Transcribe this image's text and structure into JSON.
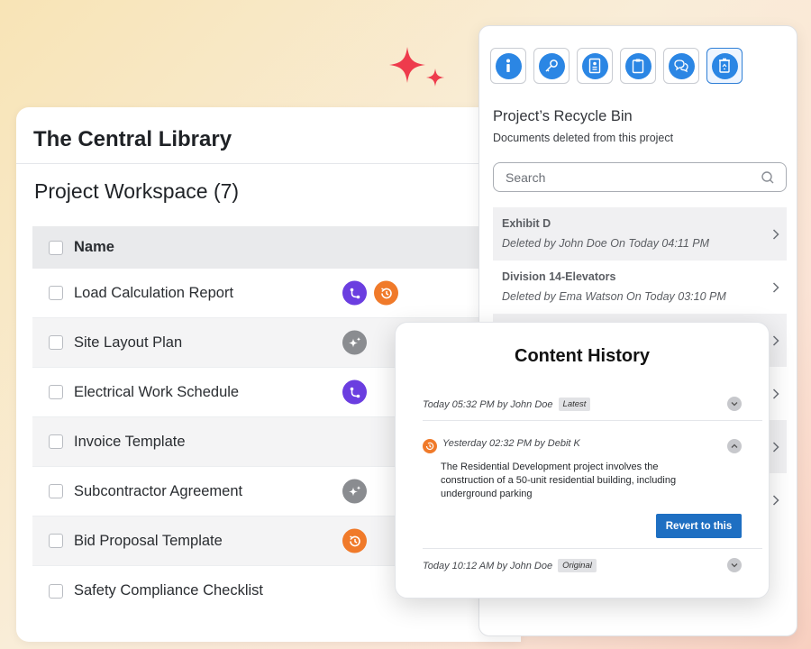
{
  "workspace": {
    "title": "The Central Library",
    "subtitle": "Project Workspace (7)",
    "header_label": "Name",
    "rows": [
      {
        "label": "Load Calculation Report",
        "badges": [
          "workflow-icon",
          "history-icon"
        ]
      },
      {
        "label": "Site Layout Plan",
        "badges": [
          "ai-sparkle-icon"
        ]
      },
      {
        "label": "Electrical Work Schedule",
        "badges": [
          "workflow-icon"
        ]
      },
      {
        "label": "Invoice Template",
        "badges": []
      },
      {
        "label": "Subcontractor Agreement",
        "badges": [
          "ai-sparkle-icon"
        ]
      },
      {
        "label": "Bid Proposal Template",
        "badges": [
          "history-icon"
        ]
      },
      {
        "label": "Safety Compliance Checklist",
        "badges": []
      }
    ]
  },
  "recycle_bin": {
    "toolbar": [
      "info-icon",
      "key-icon",
      "document-card-icon",
      "clipboard-icon",
      "chat-icon",
      "recycle-bin-icon"
    ],
    "title": "Project’s Recycle Bin",
    "subtitle": "Documents deleted from this project",
    "search_placeholder": "Search",
    "items": [
      {
        "name": "Exhibit D",
        "meta": "Deleted by John Doe On Today 04:11 PM"
      },
      {
        "name": "Division 14-Elevators",
        "meta": "Deleted by Ema Watson On Today 03:10 PM"
      }
    ]
  },
  "content_history": {
    "title": "Content History",
    "entries": [
      {
        "line": "Today 05:32 PM by John Doe",
        "tag": "Latest"
      },
      {
        "line": "Yesterday 02:32 PM by Debit K",
        "description": "The Residential Development project involves the construction of a 50-unit residential building, including underground parking"
      },
      {
        "line": "Today 10:12 AM by John Doe",
        "tag": "Original"
      }
    ],
    "revert_label": "Revert to this"
  },
  "colors": {
    "accent_blue": "#2b86e4",
    "button_blue": "#1e6fc2",
    "workflow_purple": "#6b3ee0",
    "history_orange": "#f07a2a",
    "ai_gray": "#8a8c90",
    "sparkle_red": "#ee3b4c"
  }
}
